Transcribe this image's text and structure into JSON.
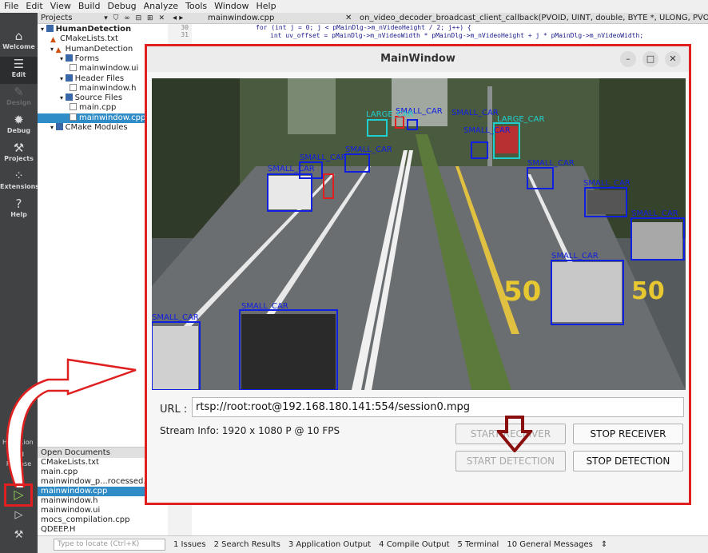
{
  "menubar": [
    "File",
    "Edit",
    "View",
    "Build",
    "Debug",
    "Analyze",
    "Tools",
    "Window",
    "Help"
  ],
  "modes": [
    {
      "label": "Welcome",
      "icon": "welcome-icon"
    },
    {
      "label": "Edit",
      "icon": "edit-icon"
    },
    {
      "label": "Design",
      "icon": "design-icon"
    },
    {
      "label": "Debug",
      "icon": "debug-icon"
    },
    {
      "label": "Projects",
      "icon": "projects-icon"
    },
    {
      "label": "Extensions",
      "icon": "extensions-icon"
    },
    {
      "label": "Help",
      "icon": "help-icon"
    }
  ],
  "kit": {
    "project": "Hum...ion",
    "config": "Release"
  },
  "projects": {
    "title": "Projects",
    "tree": [
      {
        "label": "HumanDetection",
        "depth": 0,
        "icon": "folder"
      },
      {
        "label": "CMakeLists.txt",
        "depth": 1,
        "icon": "cmake"
      },
      {
        "label": "HumanDetection",
        "depth": 1,
        "icon": "cmake"
      },
      {
        "label": "Forms",
        "depth": 2,
        "icon": "folder"
      },
      {
        "label": "mainwindow.ui",
        "depth": 3,
        "icon": "file"
      },
      {
        "label": "Header Files",
        "depth": 2,
        "icon": "folder"
      },
      {
        "label": "mainwindow.h",
        "depth": 3,
        "icon": "file"
      },
      {
        "label": "Source Files",
        "depth": 2,
        "icon": "folder"
      },
      {
        "label": "main.cpp",
        "depth": 3,
        "icon": "file"
      },
      {
        "label": "mainwindow.cpp",
        "depth": 3,
        "icon": "file",
        "selected": true
      },
      {
        "label": "CMake Modules",
        "depth": 1,
        "icon": "folder"
      }
    ]
  },
  "open_documents": {
    "title": "Open Documents",
    "items": [
      {
        "label": "CMakeLists.txt"
      },
      {
        "label": "main.cpp"
      },
      {
        "label": "mainwindow_p...rocessed.cpp"
      },
      {
        "label": "mainwindow.cpp",
        "selected": true
      },
      {
        "label": "mainwindow.h"
      },
      {
        "label": "mainwindow.ui"
      },
      {
        "label": "mocs_compilation.cpp"
      },
      {
        "label": "QDEEP.H"
      }
    ]
  },
  "editor": {
    "file_tab": "mainwindow.cpp",
    "function": "on_video_decoder_broadcast_client_callback(PVOID, UINT, double, BYTE *, ULONG, PVOID): QRETURN",
    "line_numbers": [
      "30",
      "31"
    ],
    "code_lines": [
      "for (int j = 0; j < pMainDlg->m_nVideoHeight / 2; j++) {",
      "int uv_offset = pMainDlg->m_nVideoWidth * pMainDlg->m_nVideoHeight + j * pMainDlg->m_nVideoWidth;"
    ]
  },
  "statusbar": {
    "locate_placeholder": "Type to locate (Ctrl+K)",
    "tabs": [
      "1 Issues",
      "2 Search Results",
      "3 Application Output",
      "4 Compile Output",
      "5 Terminal",
      "10 General Messages"
    ]
  },
  "mainwindow": {
    "title": "MainWindow",
    "url_label": "URL :",
    "url_value": "rtsp://root:root@192.168.180.141:554/session0.mpg",
    "stream_info": "Stream Info: 1920 x 1080 P  @ 10 FPS",
    "buttons": {
      "start_receiver": "START RECEIVER",
      "stop_receiver": "STOP RECEIVER",
      "start_detection": "START DETECTION",
      "stop_detection": "STOP DETECTION"
    },
    "detections": [
      "LARGE_CAR",
      "SMALL_CAR",
      "SMALL_CAR",
      "SMALL_CAR",
      "SMALL_CAR",
      "SMALL_CAR",
      "SMALL_CAR",
      "SMALL_CAR",
      "LARGE_CAR",
      "SMALL_CAR",
      "SMALL_CAR",
      "SMALL_CAR",
      "SMALL_CAR",
      "SMALL_CAR"
    ],
    "road_marking": "50"
  },
  "colors": {
    "annotation_red": "#e02020",
    "box_blue": "#1020e0",
    "box_cyan": "#20d0d0",
    "selection": "#308cc6"
  }
}
